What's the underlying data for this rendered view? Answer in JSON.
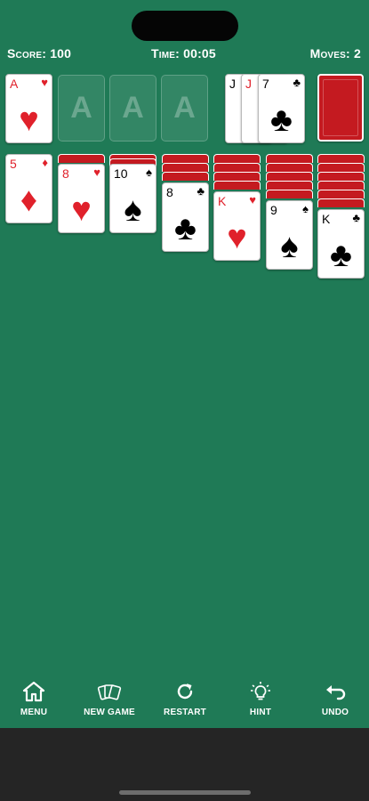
{
  "status": {
    "score_label": "Score:",
    "score_value": "100",
    "time_label": "Time:",
    "time_value": "00:05",
    "moves_label": "Moves:",
    "moves_value": "2"
  },
  "foundations": [
    {
      "rank": "A",
      "suit": "♥",
      "color": "red"
    },
    {
      "placeholder": "A"
    },
    {
      "placeholder": "A"
    },
    {
      "placeholder": "A"
    }
  ],
  "waste": [
    {
      "rank": "J",
      "color": "black"
    },
    {
      "rank": "J",
      "color": "red"
    },
    {
      "rank": "7",
      "suit": "♣",
      "color": "black"
    }
  ],
  "tableau": [
    {
      "face_down": 0,
      "top": {
        "rank": "5",
        "suit": "♦",
        "color": "red"
      }
    },
    {
      "face_down": 1,
      "top": {
        "rank": "8",
        "suit": "♥",
        "color": "red"
      }
    },
    {
      "face_down": 2,
      "top": {
        "rank": "10",
        "suit": "♠",
        "color": "black"
      }
    },
    {
      "face_down": 3,
      "top": {
        "rank": "8",
        "suit": "♣",
        "color": "black"
      }
    },
    {
      "face_down": 4,
      "top": {
        "rank": "K",
        "suit": "♥",
        "color": "red"
      }
    },
    {
      "face_down": 5,
      "top": {
        "rank": "9",
        "suit": "♠",
        "color": "black"
      }
    },
    {
      "face_down": 6,
      "top": {
        "rank": "K",
        "suit": "♣",
        "color": "black"
      }
    }
  ],
  "toolbar": [
    {
      "label": "MENU",
      "icon": "home-icon"
    },
    {
      "label": "NEW GAME",
      "icon": "cards-icon"
    },
    {
      "label": "RESTART",
      "icon": "restart-icon"
    },
    {
      "label": "HINT",
      "icon": "lightbulb-icon"
    },
    {
      "label": "UNDO",
      "icon": "undo-icon"
    }
  ],
  "colors": {
    "felt": "#1f7a56",
    "card_back": "#c41a20",
    "red_suit": "#e0212b"
  }
}
